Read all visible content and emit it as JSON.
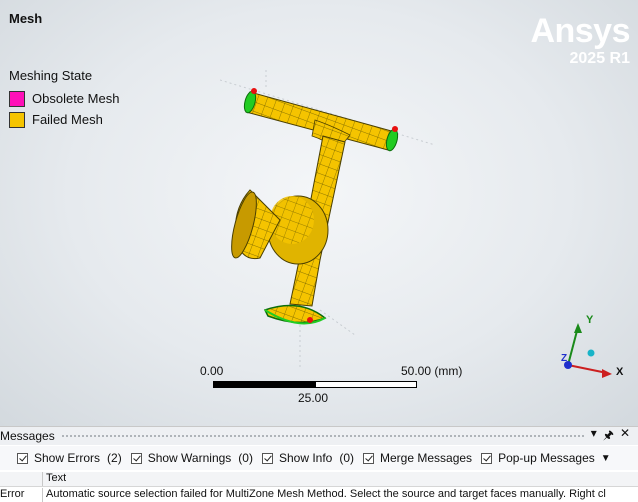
{
  "viewport": {
    "title": "Mesh",
    "brand": {
      "name": "Ansys",
      "version": "2025 R1"
    },
    "legend": {
      "title": "Meshing State",
      "items": [
        {
          "label": "Obsolete Mesh",
          "color": "#ff10b8"
        },
        {
          "label": "Failed Mesh",
          "color": "#f5c400"
        }
      ]
    },
    "scale": {
      "left": "0.00",
      "right": "50.00 (mm)",
      "middle": "25.00"
    },
    "triad": {
      "y": "Y",
      "x": "X",
      "z": "Z"
    }
  },
  "messages": {
    "title": "Messages",
    "header_icons": [
      "▾",
      "📌",
      "✕"
    ],
    "toolbar": {
      "show_errors": {
        "label": "Show Errors",
        "count": "(2)"
      },
      "show_warnings": {
        "label": "Show Warnings",
        "count": "(0)"
      },
      "show_info": {
        "label": "Show Info",
        "count": "(0)"
      },
      "merge": {
        "label": "Merge Messages"
      },
      "popup": {
        "label": "Pop-up Messages"
      }
    },
    "columns": {
      "type": "",
      "text": "Text"
    },
    "rows": [
      {
        "type": "Error",
        "text": "Automatic source selection failed for MultiZone Mesh Method. Select the source and target faces manually. Right cl"
      }
    ]
  },
  "colors": {
    "mesh": "#f5c400",
    "boundary": "#22cc22",
    "accent": "#2a66c8"
  }
}
